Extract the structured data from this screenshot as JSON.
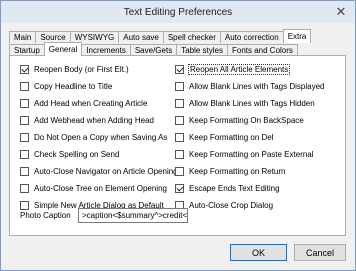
{
  "window": {
    "title": "Text Editing Preferences",
    "close_glyph": "✕"
  },
  "tabs_row1": [
    "Main",
    "Source",
    "WYSIWYG",
    "Auto save",
    "Spell checker",
    "Auto correction",
    "Extra"
  ],
  "tabs_row2": [
    "Startup",
    "General",
    "Increments",
    "Save/Gets",
    "Table styles",
    "Fonts and Colors"
  ],
  "active_tab_row1": "Extra",
  "active_tab_row2": "General",
  "left_options": [
    {
      "label": "Reopen Body (or First Elt.)",
      "checked": true
    },
    {
      "label": "Copy Headline to Title",
      "checked": false
    },
    {
      "label": "Add Head when Creating Article",
      "checked": false
    },
    {
      "label": "Add Webhead when Adding Head",
      "checked": false
    },
    {
      "label": "Do Not Open a Copy when Saving As",
      "checked": false
    },
    {
      "label": "Check Spelling on Send",
      "checked": false
    },
    {
      "label": "Auto-Close Navigator on Article Opening",
      "checked": false
    },
    {
      "label": "Auto-Close Tree on Element Opening",
      "checked": false
    },
    {
      "label": "Simple New Article Dialog as Default",
      "checked": false
    }
  ],
  "right_options": [
    {
      "label": "Reopen All Article Elements",
      "checked": true,
      "focused": true
    },
    {
      "label": "Allow Blank Lines with Tags Displayed",
      "checked": false
    },
    {
      "label": "Allow Blank Lines with Tags Hidden",
      "checked": false
    },
    {
      "label": "Keep Formatting On BackSpace",
      "checked": false
    },
    {
      "label": "Keep Formatting on Del",
      "checked": false
    },
    {
      "label": "Keep Formatting on Paste External",
      "checked": false
    },
    {
      "label": "Keep Formatting on Return",
      "checked": false
    },
    {
      "label": "Escape Ends Text Editing",
      "checked": true
    },
    {
      "label": "Auto-Close Crop Dialog",
      "checked": false
    }
  ],
  "photo_caption": {
    "label": "Photo Caption",
    "value": ">caption<$summary^>credit<$autho"
  },
  "buttons": {
    "ok": "OK",
    "cancel": "Cancel"
  }
}
